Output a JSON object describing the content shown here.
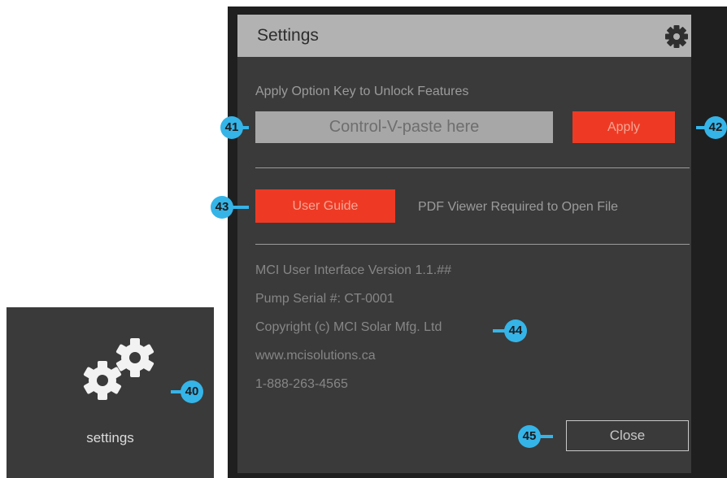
{
  "tile": {
    "label": "settings"
  },
  "dialog": {
    "title": "Settings",
    "option_key_label": "Apply Option Key to Unlock Features",
    "option_key_placeholder": "Control-V-paste here",
    "apply_label": "Apply",
    "user_guide_label": "User Guide",
    "pdf_note": "PDF Viewer Required to Open File",
    "info": [
      "MCI User Interface Version 1.1.##",
      "Pump Serial #: CT-0001",
      "Copyright (c) MCI Solar Mfg. Ltd",
      "www.mcisolutions.ca",
      "1-888-263-4565"
    ],
    "close_label": "Close"
  },
  "markers": {
    "m40": "40",
    "m41": "41",
    "m42": "42",
    "m43": "43",
    "m44": "44",
    "m45": "45"
  },
  "colors": {
    "accent_red": "#ee3a24",
    "marker_blue": "#35b4e8",
    "panel_dark": "#3a3a3a",
    "titlebar_gray": "#b2b2b2"
  },
  "icons": {
    "tile": "gears-icon",
    "titlebar": "gear-icon"
  }
}
